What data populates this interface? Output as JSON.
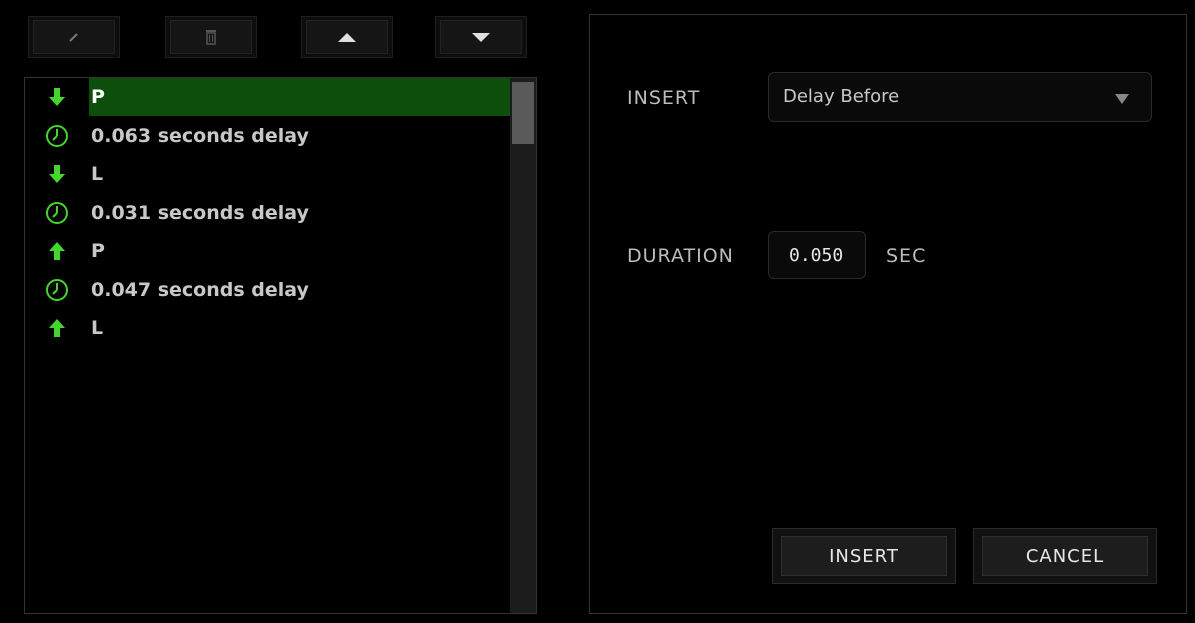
{
  "toolbar": {
    "buttons": [
      {
        "name": "edit",
        "icon": "pencil-icon"
      },
      {
        "name": "delete",
        "icon": "trash-icon"
      },
      {
        "name": "move-up",
        "icon": "triangle-up-icon"
      },
      {
        "name": "move-down",
        "icon": "triangle-down-icon"
      }
    ]
  },
  "macro_list": {
    "items": [
      {
        "type": "key-down",
        "icon": "arrow-down-icon",
        "label": "P",
        "selected": true
      },
      {
        "type": "delay",
        "icon": "clock-icon",
        "label": "0.063 seconds delay",
        "selected": false
      },
      {
        "type": "key-down",
        "icon": "arrow-down-icon",
        "label": "L",
        "selected": false
      },
      {
        "type": "delay",
        "icon": "clock-icon",
        "label": "0.031 seconds delay",
        "selected": false
      },
      {
        "type": "key-up",
        "icon": "arrow-up-icon",
        "label": "P",
        "selected": false
      },
      {
        "type": "delay",
        "icon": "clock-icon",
        "label": "0.047 seconds delay",
        "selected": false
      },
      {
        "type": "key-up",
        "icon": "arrow-up-icon",
        "label": "L",
        "selected": false
      }
    ]
  },
  "form": {
    "insert_label": "INSERT",
    "insert_value": "Delay Before",
    "duration_label": "DURATION",
    "duration_value": "0.050",
    "duration_unit": "SEC"
  },
  "actions": {
    "insert_label": "INSERT",
    "cancel_label": "CANCEL"
  },
  "colors": {
    "accent_green": "#44d62c",
    "selected_row": "#0d4e0d",
    "background": "#000000"
  }
}
